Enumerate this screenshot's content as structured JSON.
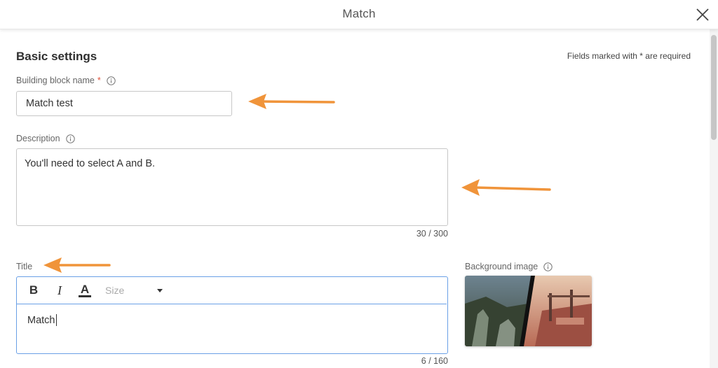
{
  "modal": {
    "title": "Match"
  },
  "basic_settings": {
    "heading": "Basic settings",
    "required_note": "Fields marked with * are required"
  },
  "building_block": {
    "label": "Building block name",
    "required_marker": "*",
    "value": "Match test"
  },
  "description": {
    "label": "Description",
    "value": "You'll need to select A and B.",
    "counter": "30 / 300"
  },
  "title_field": {
    "label": "Title",
    "toolbar": {
      "bold": "B",
      "italic": "I",
      "color": "A",
      "size_placeholder": "Size"
    },
    "value": "Match",
    "counter": "6 / 160"
  },
  "background_image": {
    "label": "Background image"
  },
  "colors": {
    "arrow": "#F0943A",
    "focus_border": "#6AA0E6",
    "required": "#E0513A"
  }
}
